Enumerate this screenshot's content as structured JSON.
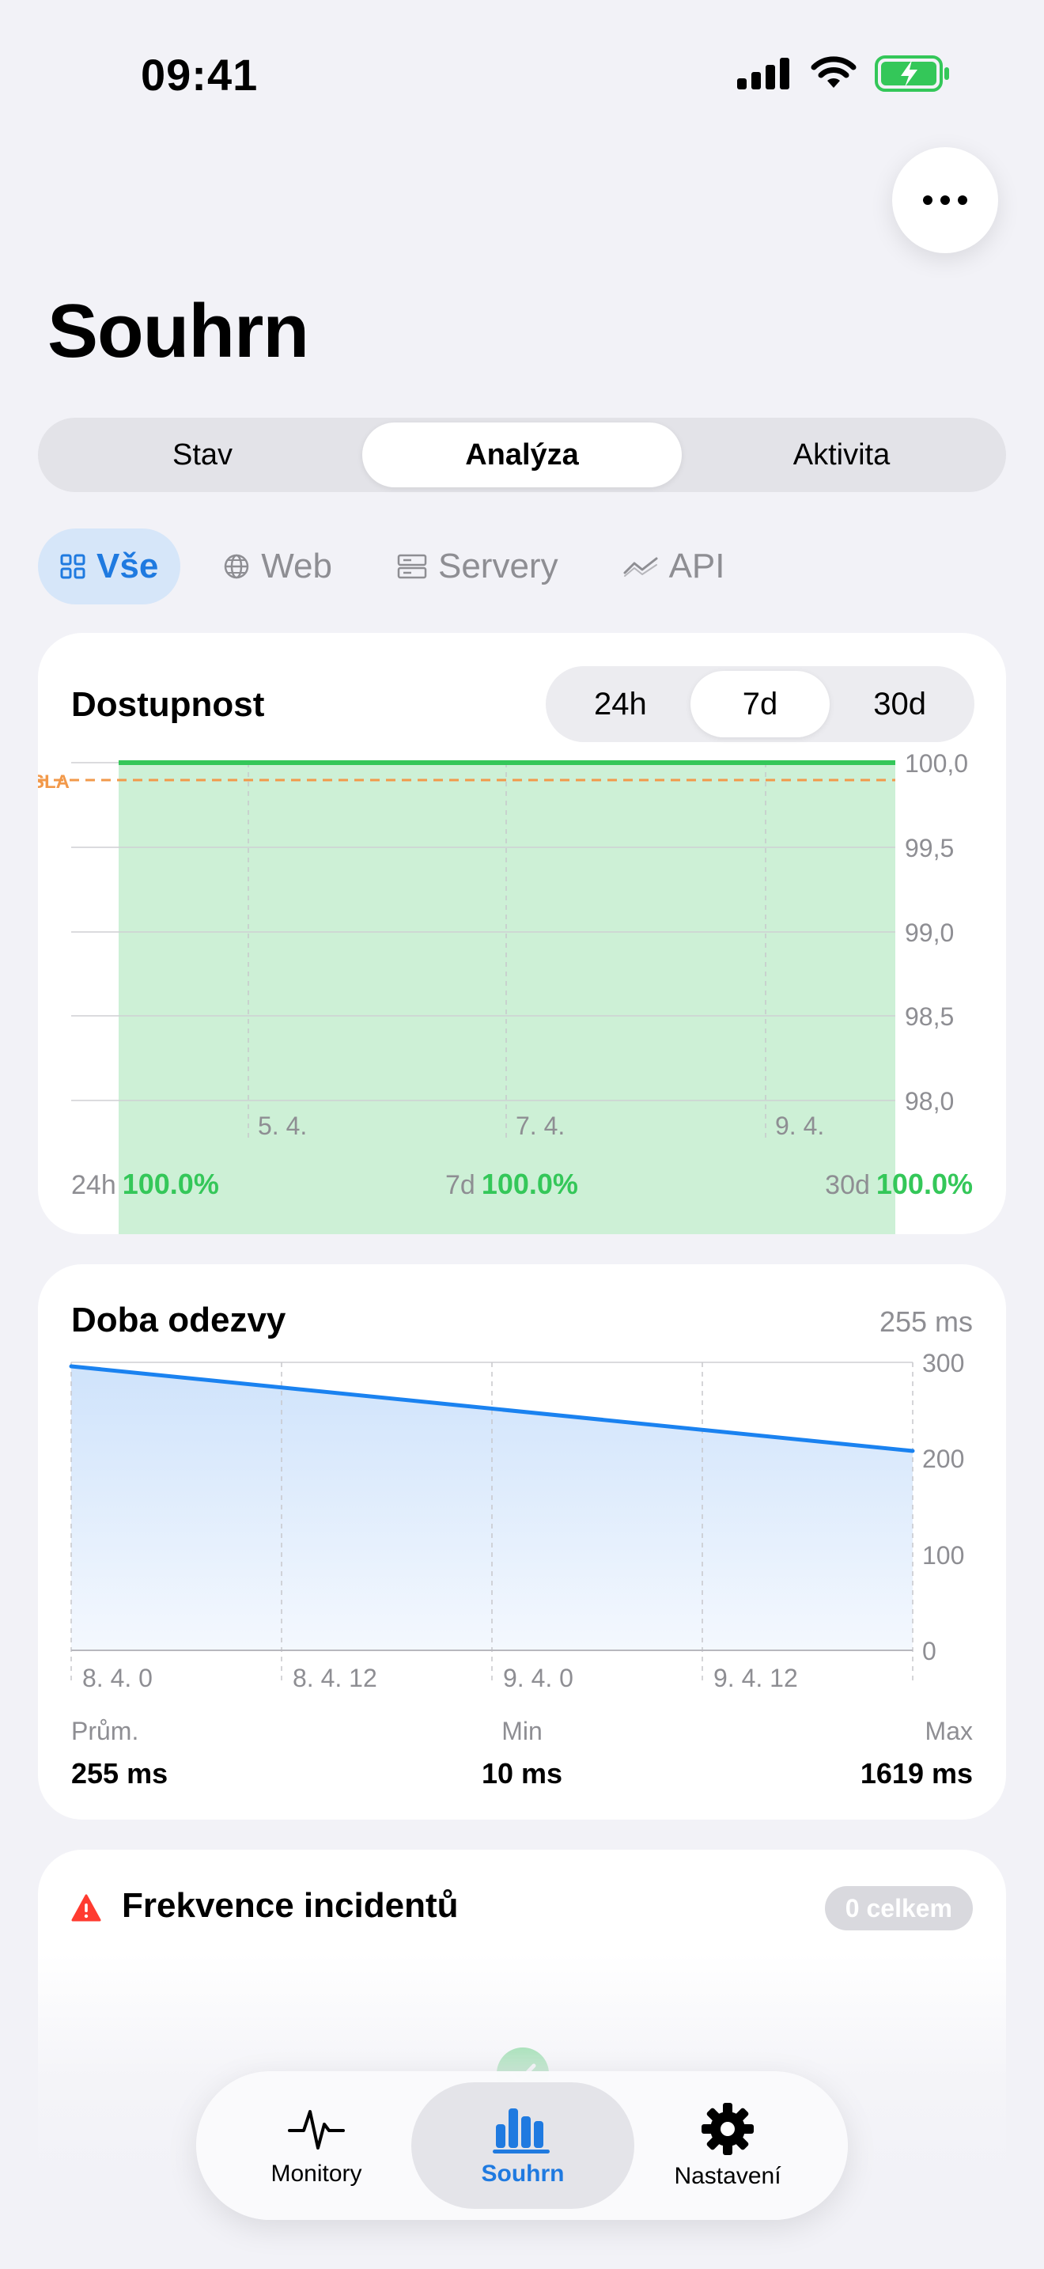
{
  "status_bar": {
    "time": "09:41"
  },
  "page": {
    "title": "Souhrn"
  },
  "segments": [
    "Stav",
    "Analýza",
    "Aktivita"
  ],
  "segments_active": "Analýza",
  "filters": [
    {
      "label": "Vše",
      "icon": "grid-icon",
      "active": true
    },
    {
      "label": "Web",
      "icon": "globe-icon",
      "active": false
    },
    {
      "label": "Servery",
      "icon": "server-icon",
      "active": false
    },
    {
      "label": "API",
      "icon": "trend-icon",
      "active": false
    }
  ],
  "availability": {
    "title": "Dostupnost",
    "ranges": [
      "24h",
      "7d",
      "30d"
    ],
    "active_range": "7d",
    "sla_label": "SLA",
    "stats": [
      {
        "period": "24h",
        "value": "100.0%"
      },
      {
        "period": "7d",
        "value": "100.0%"
      },
      {
        "period": "30d",
        "value": "100.0%"
      }
    ]
  },
  "response_time": {
    "title": "Doba odezvy",
    "current": "255 ms",
    "stats": {
      "avg_label": "Prům.",
      "avg_value": "255 ms",
      "min_label": "Min",
      "min_value": "10 ms",
      "max_label": "Max",
      "max_value": "1619 ms"
    }
  },
  "incidents": {
    "title": "Frekvence incidentů",
    "badge": "0 celkem"
  },
  "tabbar": {
    "items": [
      {
        "label": "Monitory",
        "icon": "pulse-icon"
      },
      {
        "label": "Souhrn",
        "icon": "bar-chart-icon",
        "active": true
      },
      {
        "label": "Nastavení",
        "icon": "gear-icon"
      }
    ]
  },
  "colors": {
    "accent": "#1f7ae0",
    "green": "#34c759",
    "sla": "#f2994a",
    "line": "#1a82f0"
  },
  "chart_data": [
    {
      "type": "area",
      "title": "Dostupnost",
      "x": [
        "5. 4.",
        "7. 4.",
        "9. 4."
      ],
      "series": [
        {
          "values": [
            100.0,
            100.0,
            100.0
          ]
        }
      ],
      "ylim": [
        98.0,
        100.0
      ],
      "yticks": [
        "100,0",
        "99,5",
        "99,0",
        "98,5",
        "98,0"
      ],
      "sla_threshold": 99.9,
      "grid": true
    },
    {
      "type": "area",
      "title": "Doba odezvy",
      "x": [
        "8. 4. 0",
        "8. 4. 12",
        "9. 4. 0",
        "9. 4. 12"
      ],
      "series": [
        {
          "x_start": "8. 4. 0",
          "y_start": 295,
          "y_end": 207
        }
      ],
      "ylim": [
        0,
        300
      ],
      "yticks": [
        "300",
        "200",
        "100",
        "0"
      ],
      "grid": true
    }
  ]
}
